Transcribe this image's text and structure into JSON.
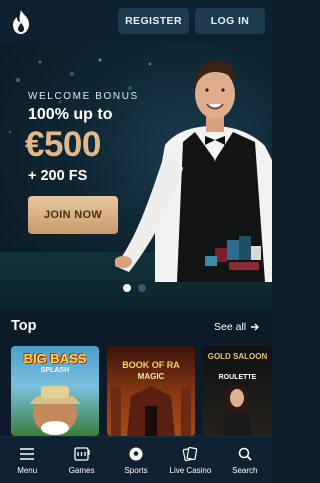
{
  "header": {
    "logo_icon": "flame-logo-icon",
    "register_label": "REGISTER",
    "login_label": "LOG IN"
  },
  "hero": {
    "welcome": "WELCOME BONUS",
    "headline": "100% up to",
    "amount": "€500",
    "free_spins": "+ 200 FS",
    "cta_label": "JOIN NOW",
    "carousel": {
      "count": 2,
      "active": 1
    }
  },
  "section": {
    "title": "Top",
    "see_all": "See all",
    "games": [
      {
        "name_line1": "BIG BASS",
        "name_line2": "SPLASH"
      },
      {
        "name_line1": "BOOK OF RA",
        "name_line2": "MAGIC"
      },
      {
        "name_line1": "GOLD SALOON",
        "name_line2": "ROULETTE"
      }
    ]
  },
  "nav": {
    "items": [
      {
        "label": "Menu",
        "icon": "menu-icon"
      },
      {
        "label": "Games",
        "icon": "slot-machine-icon"
      },
      {
        "label": "Sports",
        "icon": "soccer-ball-icon"
      },
      {
        "label": "Live Casino",
        "icon": "cards-icon"
      },
      {
        "label": "Search",
        "icon": "search-icon"
      }
    ]
  },
  "colors": {
    "background": "#0c1b27",
    "header": "#0e2130",
    "button": "#1d3a4f",
    "accent_gold": "#e0b88c"
  }
}
